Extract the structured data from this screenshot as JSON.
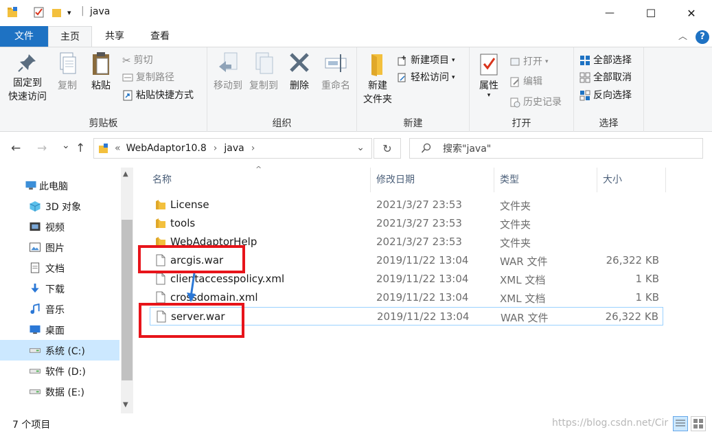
{
  "window": {
    "title": "java",
    "minimize_glyph": "—",
    "maximize_glyph": "☐",
    "close_glyph": "✕"
  },
  "ribbon_tabs": {
    "file": "文件",
    "home": "主页",
    "share": "共享",
    "view": "查看",
    "collapse_glyph": "︿",
    "help_glyph": "?"
  },
  "ribbon": {
    "clipboard": {
      "label": "剪贴板",
      "pin_line1": "固定到",
      "pin_line2": "快速访问",
      "copy": "复制",
      "paste": "粘贴",
      "cut": "剪切",
      "copy_path": "复制路径",
      "paste_shortcut": "粘贴快捷方式"
    },
    "organize": {
      "label": "组织",
      "move_to": "移动到",
      "copy_to": "复制到",
      "delete": "删除",
      "rename": "重命名"
    },
    "new": {
      "label": "新建",
      "new_folder_line1": "新建",
      "new_folder_line2": "文件夹",
      "new_item": "新建项目",
      "easy_access": "轻松访问"
    },
    "open": {
      "label": "打开",
      "properties": "属性",
      "open": "打开",
      "edit": "编辑",
      "history": "历史记录"
    },
    "select": {
      "label": "选择",
      "select_all": "全部选择",
      "select_none": "全部取消",
      "invert": "反向选择"
    }
  },
  "navigation": {
    "back_glyph": "←",
    "forward_glyph": "→",
    "recent_glyph": "⌄",
    "up_glyph": "↑",
    "breadcrumb_prefix": "«",
    "breadcrumb": [
      "WebAdaptor10.8",
      "java"
    ],
    "breadcrumb_sep": "›",
    "dropdown_glyph": "⌄",
    "refresh_glyph": "↻",
    "search_placeholder": "搜索\"java\""
  },
  "nav_pane": {
    "items": [
      {
        "label": "此电脑",
        "icon": "computer-icon"
      },
      {
        "label": "3D 对象",
        "icon": "3d-objects-icon"
      },
      {
        "label": "视频",
        "icon": "video-icon"
      },
      {
        "label": "图片",
        "icon": "pictures-icon"
      },
      {
        "label": "文档",
        "icon": "documents-icon"
      },
      {
        "label": "下载",
        "icon": "download-icon"
      },
      {
        "label": "音乐",
        "icon": "music-icon"
      },
      {
        "label": "桌面",
        "icon": "desktop-icon"
      },
      {
        "label": "系统 (C:)",
        "icon": "drive-icon",
        "selected": true
      },
      {
        "label": "软件 (D:)",
        "icon": "drive-icon"
      },
      {
        "label": "数据 (E:)",
        "icon": "drive-icon"
      }
    ]
  },
  "file_list": {
    "columns": {
      "name": "名称",
      "date": "修改日期",
      "type": "类型",
      "size": "大小"
    },
    "sort_glyph": "^",
    "rows": [
      {
        "name": "License",
        "date": "2021/3/27 23:53",
        "type": "文件夹",
        "size": "",
        "kind": "folder"
      },
      {
        "name": "tools",
        "date": "2021/3/27 23:53",
        "type": "文件夹",
        "size": "",
        "kind": "folder"
      },
      {
        "name": "WebAdaptorHelp",
        "date": "2021/3/27 23:53",
        "type": "文件夹",
        "size": "",
        "kind": "folder"
      },
      {
        "name": "arcgis.war",
        "date": "2019/11/22 13:04",
        "type": "WAR 文件",
        "size": "26,322 KB",
        "kind": "file"
      },
      {
        "name": "clientaccesspolicy.xml",
        "date": "2019/11/22 13:04",
        "type": "XML 文档",
        "size": "1 KB",
        "kind": "file"
      },
      {
        "name": "crossdomain.xml",
        "date": "2019/11/22 13:04",
        "type": "XML 文档",
        "size": "1 KB",
        "kind": "file"
      },
      {
        "name": "server.war",
        "date": "2019/11/22 13:04",
        "type": "WAR 文件",
        "size": "26,322 KB",
        "kind": "file",
        "selected": true
      }
    ]
  },
  "status_bar": {
    "item_count": "7 个项目",
    "watermark": "https://blog.csdn.net/Cir"
  },
  "colors": {
    "accent": "#1e72c3",
    "selection": "#cce8ff",
    "annotation": "#e7141a",
    "folder": "#f3c03d"
  }
}
